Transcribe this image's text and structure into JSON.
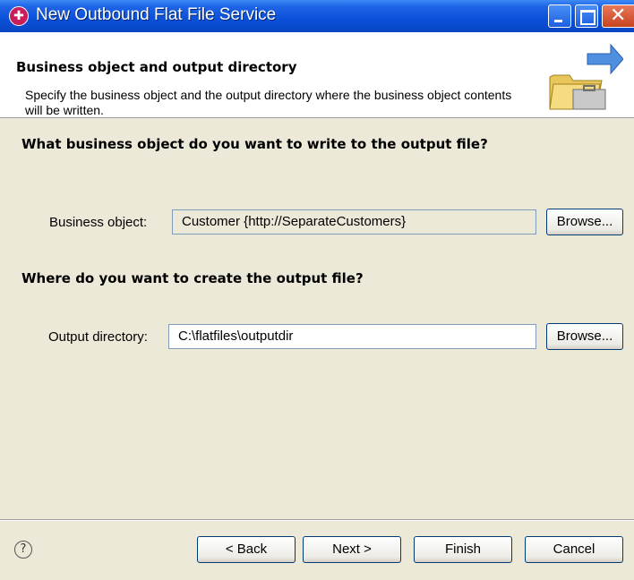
{
  "window": {
    "title": "New Outbound Flat File Service"
  },
  "banner": {
    "title": "Business object and output directory",
    "description": "Specify the business object and the output directory where the business object contents will be written."
  },
  "business_object": {
    "heading": "What business object do you want to write to the output file?",
    "label": "Business object:",
    "value": "Customer  {http://SeparateCustomers}",
    "browse_label": "Browse..."
  },
  "output_directory": {
    "heading": "Where do you want to create the output file?",
    "label": "Output directory:",
    "value": "C:\\flatfiles\\outputdir",
    "browse_label": "Browse..."
  },
  "footer": {
    "help_icon": "question-circle-icon",
    "back_label": "< Back",
    "next_label": "Next >",
    "finish_label": "Finish",
    "cancel_label": "Cancel"
  },
  "colors": {
    "titlebar": "#0a50d8",
    "dialog_background": "#ece9d8",
    "banner_background": "#ffffff",
    "close_button": "#c9431f"
  }
}
